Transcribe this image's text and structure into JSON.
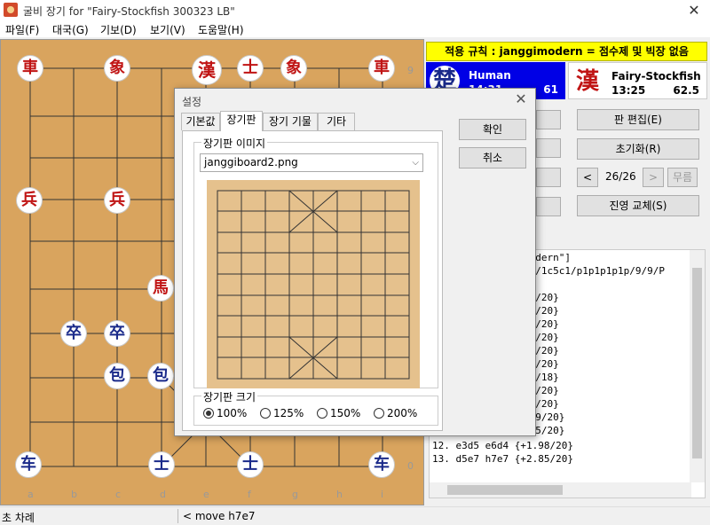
{
  "window": {
    "title": "굴비 장기 for \"Fairy-Stockfish 300323 LB\"",
    "close_glyph": "✕"
  },
  "menu": [
    {
      "label": "파일(F)"
    },
    {
      "label": "대국(G)"
    },
    {
      "label": "기보(D)"
    },
    {
      "label": "보기(V)"
    },
    {
      "label": "도움말(H)"
    }
  ],
  "board": {
    "files": [
      "a",
      "b",
      "c",
      "d",
      "e",
      "f",
      "g",
      "h",
      "i"
    ],
    "ranks_shown": [
      "9",
      "0"
    ],
    "pieces": [
      {
        "glyph": "車",
        "side": "red"
      },
      {
        "glyph": "象",
        "side": "red"
      },
      {
        "glyph": "漢",
        "side": "red"
      },
      {
        "glyph": "士",
        "side": "red"
      },
      {
        "glyph": "象",
        "side": "red"
      },
      {
        "glyph": "車",
        "side": "red"
      },
      {
        "glyph": "兵",
        "side": "red"
      },
      {
        "glyph": "兵",
        "side": "red"
      },
      {
        "glyph": "馬",
        "side": "red"
      },
      {
        "glyph": "卒",
        "side": "blue"
      },
      {
        "glyph": "卒",
        "side": "blue"
      },
      {
        "glyph": "包",
        "side": "blue"
      },
      {
        "glyph": "包",
        "side": "blue"
      },
      {
        "glyph": "车",
        "side": "blue"
      },
      {
        "glyph": "士",
        "side": "blue"
      },
      {
        "glyph": "士",
        "side": "blue"
      },
      {
        "glyph": "车",
        "side": "blue"
      }
    ]
  },
  "rule_bar": "적용 규칙 : janggimodern = 점수제 및 빅장 없음",
  "players": {
    "human": {
      "icon": "楚",
      "name": "Human",
      "time": "14:31",
      "score": "61",
      "color": "#0000e6"
    },
    "engine": {
      "icon": "漢",
      "name": "Fairy-Stockfish",
      "time": "13:25",
      "score": "62.5"
    }
  },
  "buttons": {
    "board_edit": "판 편집(E)",
    "reset": "초기화(R)",
    "prev": "<",
    "move_counter": "26/26",
    "next": ">",
    "draw": "무름",
    "swap_sides": "진영 교체(S)"
  },
  "log": {
    "lines": [
      "modern\"]",
      "k4/1c5c1/p1p1p1p1p/9/9/P",
      "00/20}",
      "00/20}",
      "01/20}",
      "06/20}",
      "00/20}",
      "17/20}",
      "53/18}",
      "64/20}",
      "75/20}",
      ".89/20}",
      ".85/20}",
      "12. e3d5 e6d4 {+1.98/20}",
      "13. d5e7 h7e7 {+2.85/20}"
    ]
  },
  "status": {
    "left": "초 차례",
    "right": "< move h7e7"
  },
  "dialog": {
    "title": "설정",
    "close_glyph": "✕",
    "tabs": [
      "기본값",
      "장기판",
      "장기 기물",
      "기타"
    ],
    "active_tab": "장기판",
    "board_image_group": "장기판 이미지",
    "board_image_value": "janggiboard2.png",
    "board_size_group": "장기판 크기",
    "size_options": [
      "100%",
      "125%",
      "150%",
      "200%"
    ],
    "size_selected": "100%",
    "ok": "확인",
    "cancel": "취소"
  }
}
